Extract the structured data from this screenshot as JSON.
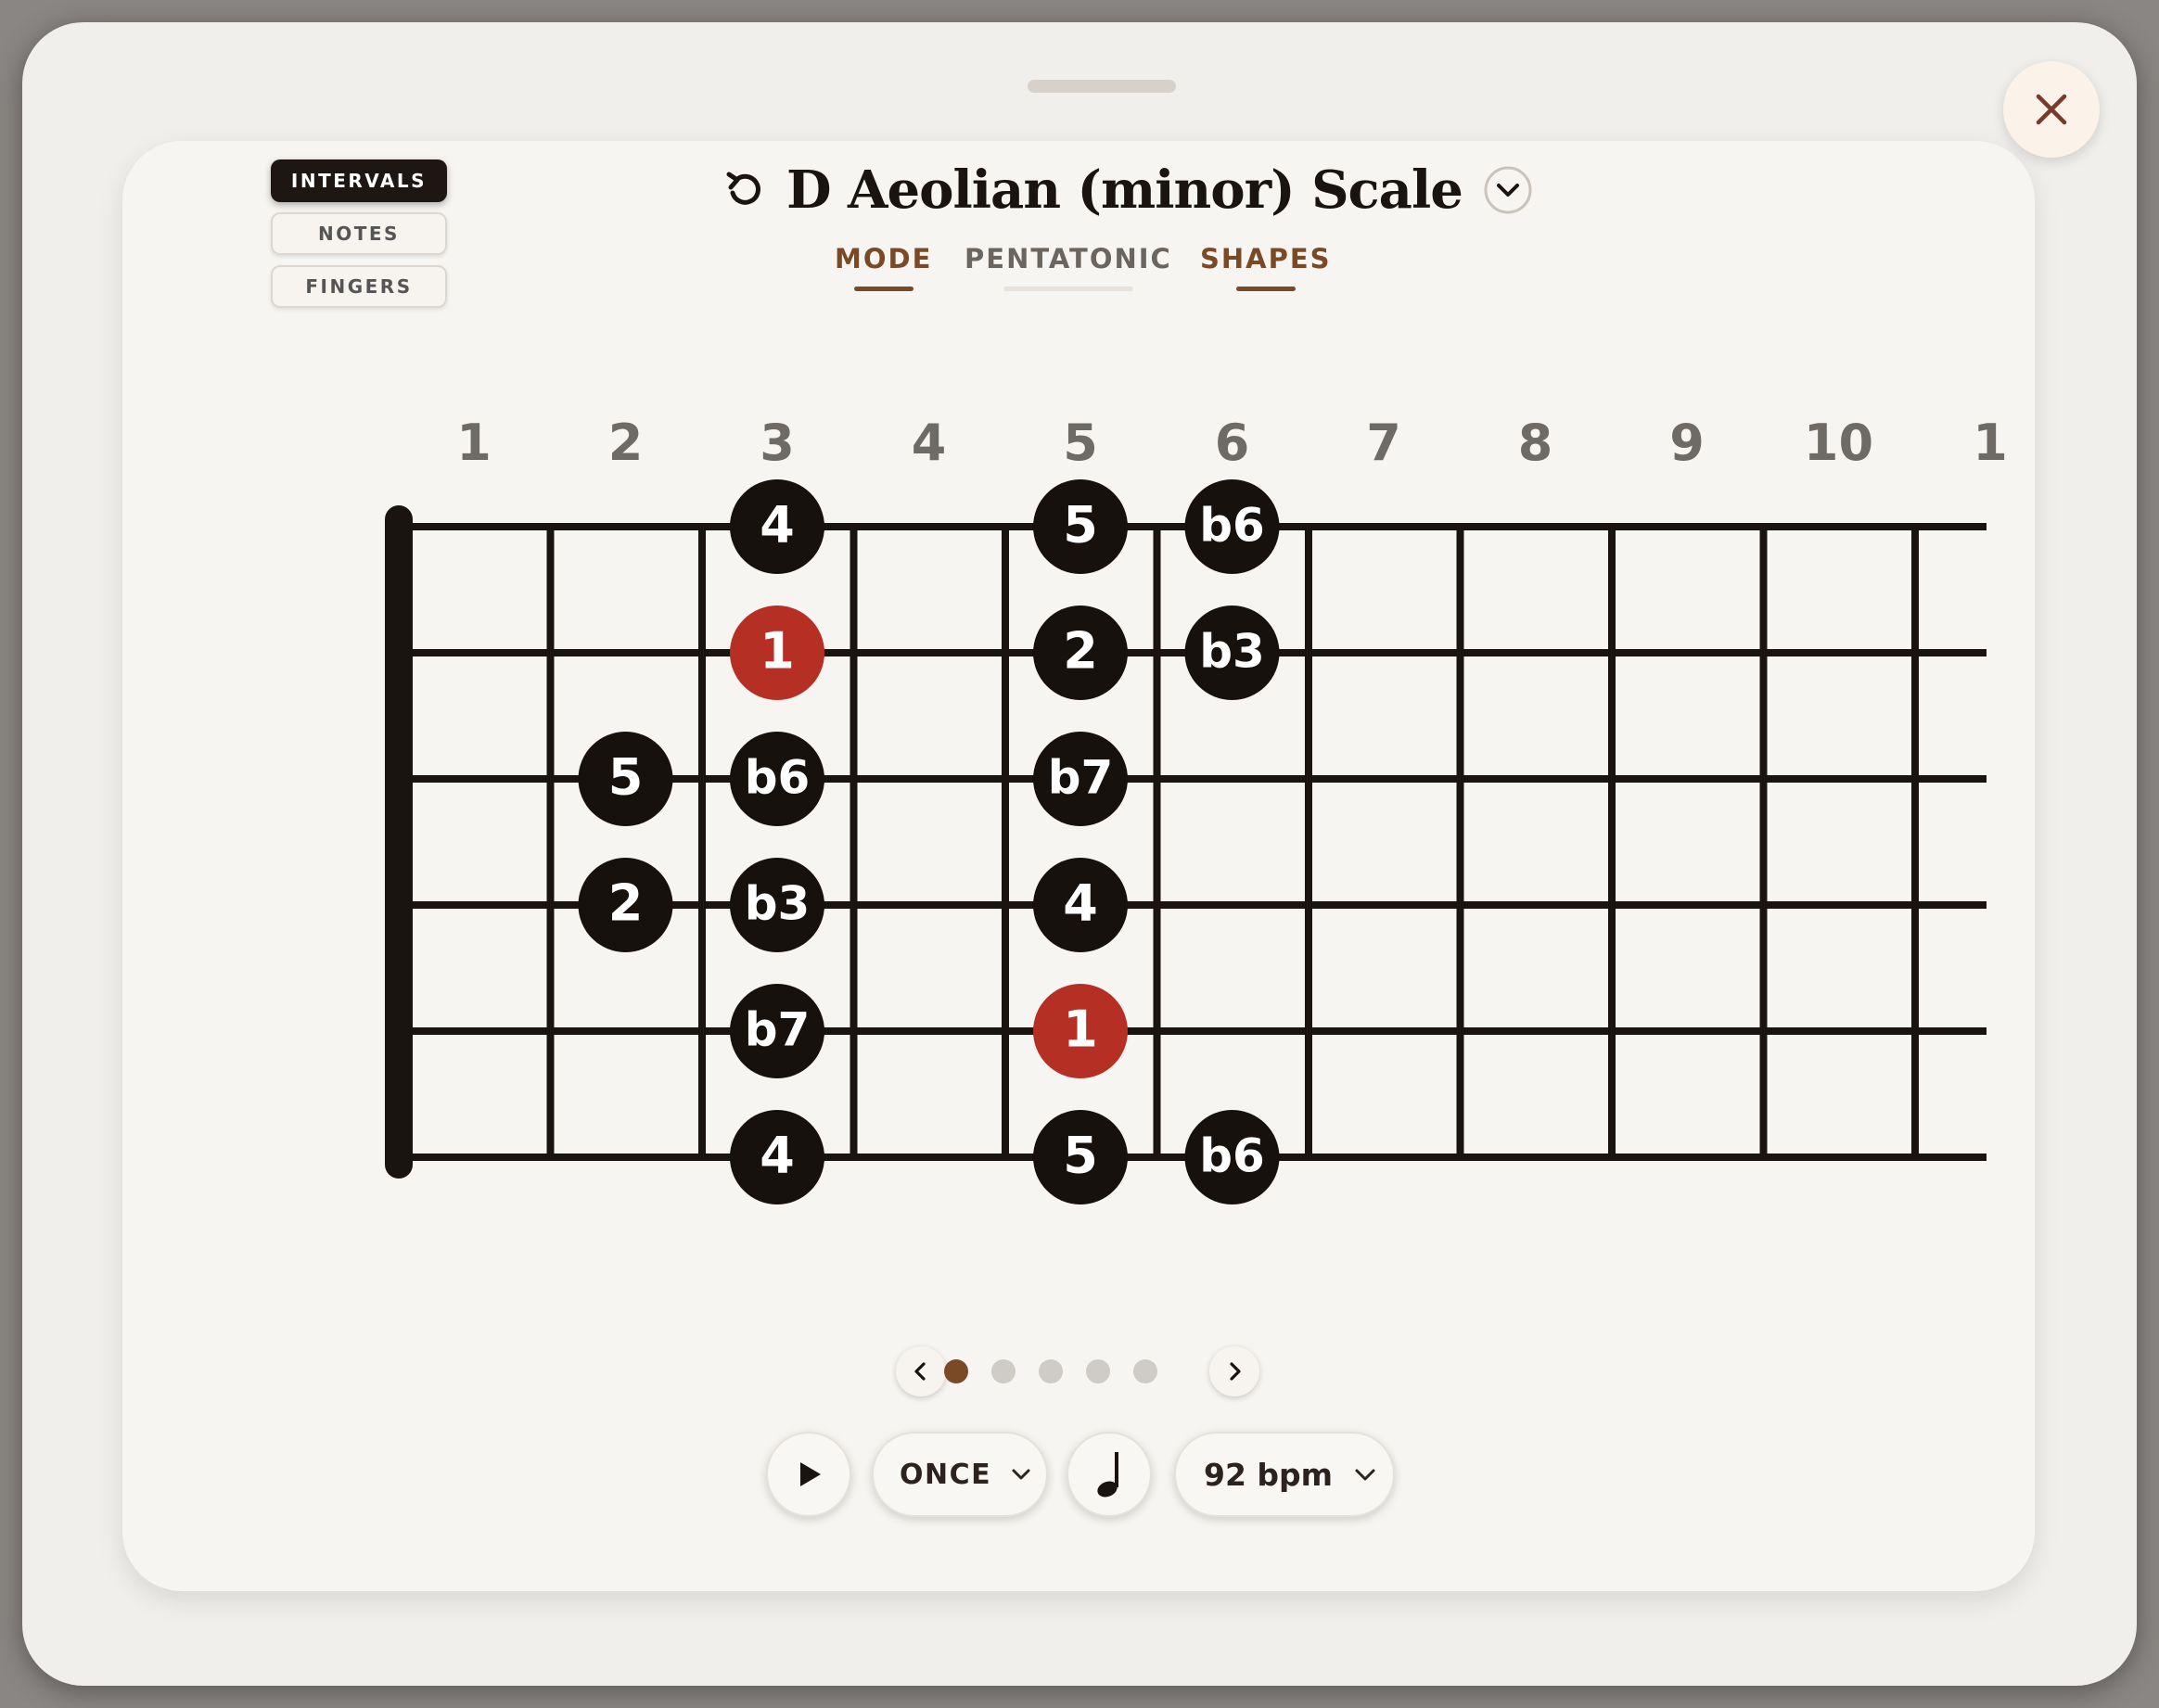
{
  "modal": {
    "close_icon": "close-icon"
  },
  "view_modes": {
    "items": [
      {
        "label": "INTERVALS",
        "active": true
      },
      {
        "label": "NOTES",
        "active": false
      },
      {
        "label": "FINGERS",
        "active": false
      }
    ]
  },
  "header": {
    "title": "D Aeolian (minor) Scale",
    "reset_icon": "rotate-ccw-icon",
    "dropdown_icon": "chevron-down-icon"
  },
  "tabs": [
    {
      "label": "MODE",
      "active": true
    },
    {
      "label": "PENTATONIC",
      "active": false
    },
    {
      "label": "SHAPES",
      "active": true
    }
  ],
  "fretboard": {
    "fret_numbers": [
      "1",
      "2",
      "3",
      "4",
      "5",
      "6",
      "7",
      "8",
      "9",
      "10",
      "1"
    ],
    "strings": 6,
    "notes": [
      {
        "string": 1,
        "fret": 3,
        "label": "4",
        "root": false
      },
      {
        "string": 1,
        "fret": 5,
        "label": "5",
        "root": false
      },
      {
        "string": 1,
        "fret": 6,
        "label": "b6",
        "root": false
      },
      {
        "string": 2,
        "fret": 3,
        "label": "1",
        "root": true
      },
      {
        "string": 2,
        "fret": 5,
        "label": "2",
        "root": false
      },
      {
        "string": 2,
        "fret": 6,
        "label": "b3",
        "root": false
      },
      {
        "string": 3,
        "fret": 2,
        "label": "5",
        "root": false
      },
      {
        "string": 3,
        "fret": 3,
        "label": "b6",
        "root": false
      },
      {
        "string": 3,
        "fret": 5,
        "label": "b7",
        "root": false
      },
      {
        "string": 4,
        "fret": 2,
        "label": "2",
        "root": false
      },
      {
        "string": 4,
        "fret": 3,
        "label": "b3",
        "root": false
      },
      {
        "string": 4,
        "fret": 5,
        "label": "4",
        "root": false
      },
      {
        "string": 5,
        "fret": 3,
        "label": "b7",
        "root": false
      },
      {
        "string": 5,
        "fret": 5,
        "label": "1",
        "root": true
      },
      {
        "string": 6,
        "fret": 3,
        "label": "4",
        "root": false
      },
      {
        "string": 6,
        "fret": 5,
        "label": "5",
        "root": false
      },
      {
        "string": 6,
        "fret": 6,
        "label": "b6",
        "root": false
      }
    ]
  },
  "pager": {
    "total": 5,
    "current": 1,
    "prev_icon": "chevron-left-icon",
    "next_icon": "chevron-right-icon"
  },
  "controls": {
    "play_icon": "play-icon",
    "repeat_label": "ONCE",
    "note_icon": "quarter-note-icon",
    "tempo_label": "92 bpm"
  },
  "colors": {
    "note_fill": "#17110e",
    "root_fill": "#b52f24",
    "accent": "#7a4a26",
    "inactive_dot": "#cfcbc6"
  }
}
